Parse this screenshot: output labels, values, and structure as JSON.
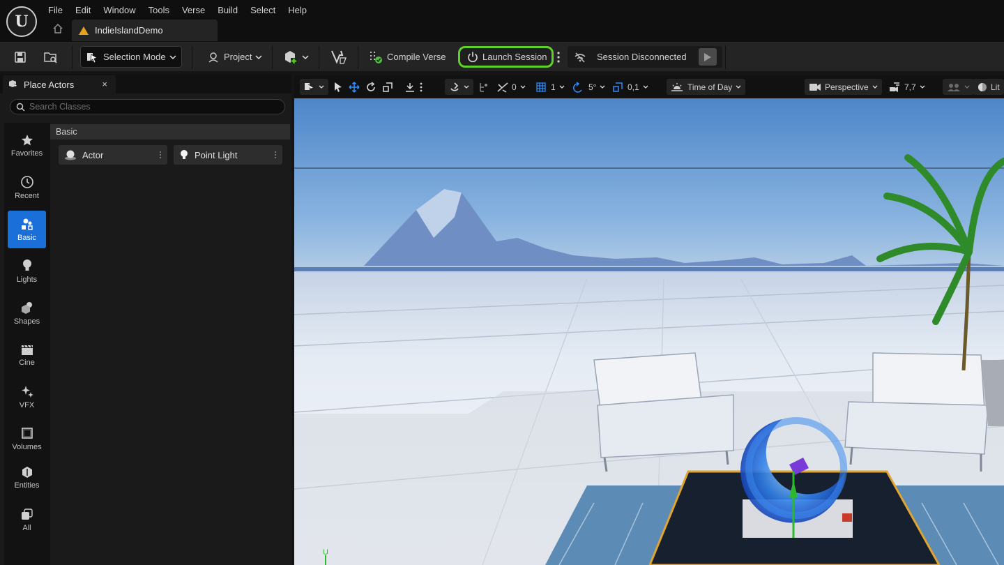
{
  "app": {
    "logo_glyph": "U",
    "menu": [
      "File",
      "Edit",
      "Window",
      "Tools",
      "Verse",
      "Build",
      "Select",
      "Help"
    ],
    "project_tab": "IndieIslandDemo"
  },
  "toolbar": {
    "selection_mode": "Selection Mode",
    "project": "Project",
    "compile_verse": "Compile Verse",
    "launch_session": "Launch Session",
    "session_status": "Session Disconnected",
    "accent": "#5fd12a"
  },
  "place_actors": {
    "tab_title": "Place Actors",
    "close_glyph": "×",
    "search_placeholder": "Search Classes",
    "categories": [
      {
        "label": "Favorites",
        "icon": "star-icon"
      },
      {
        "label": "Recent",
        "icon": "clock-icon"
      },
      {
        "label": "Basic",
        "icon": "basic-shapes-icon",
        "active": true
      },
      {
        "label": "Lights",
        "icon": "bulb-icon"
      },
      {
        "label": "Shapes",
        "icon": "shapes-icon"
      },
      {
        "label": "Cine",
        "icon": "clapper-icon"
      },
      {
        "label": "VFX",
        "icon": "sparkle-icon"
      },
      {
        "label": "Volumes",
        "icon": "volume-icon"
      },
      {
        "label": "Entities",
        "icon": "entity-icon"
      },
      {
        "label": "All",
        "icon": "all-icon"
      }
    ],
    "section_title": "Basic",
    "items": [
      "Actor",
      "Point Light"
    ]
  },
  "viewport": {
    "snap_rotation": "0",
    "grid_snap": "1",
    "rotation_snap": "5°",
    "scale_snap": "0,1",
    "time_of_day": "Time of Day",
    "view_mode": "Perspective",
    "camera_speed": "7,7",
    "lit": "Lit",
    "axis_label": "U"
  }
}
